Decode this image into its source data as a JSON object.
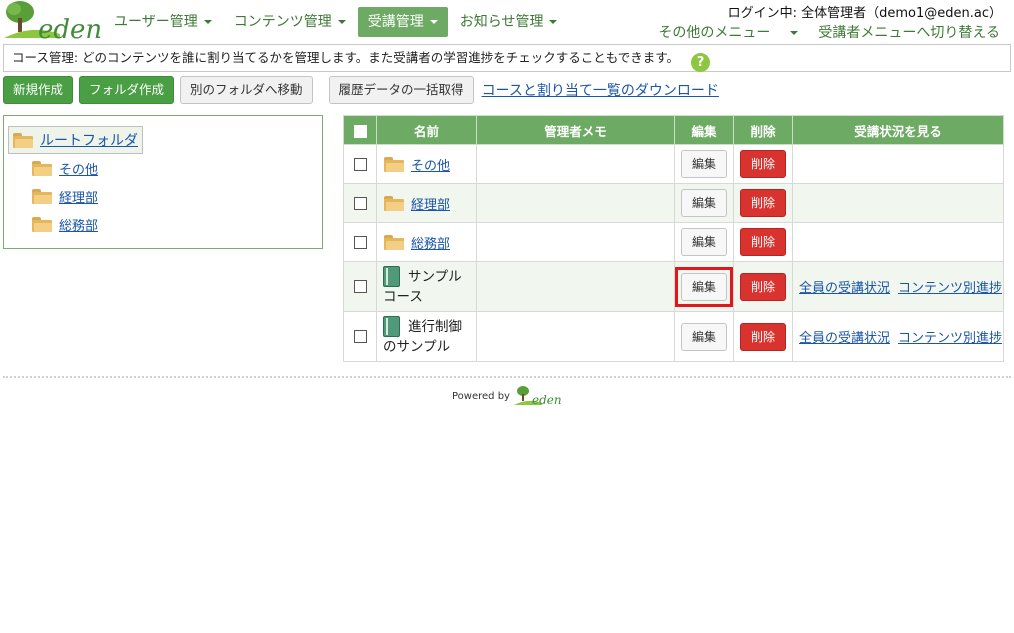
{
  "header": {
    "logo_text": "eden",
    "nav": [
      {
        "label": "ユーザー管理",
        "active": false
      },
      {
        "label": "コンテンツ管理",
        "active": false
      },
      {
        "label": "受講管理",
        "active": true
      },
      {
        "label": "お知らせ管理",
        "active": false
      }
    ],
    "login_text": "ログイン中: 全体管理者（demo1@eden.ac）",
    "other_menu": "その他のメニュー",
    "switch_menu": "受講者メニューへ切り替える"
  },
  "info": {
    "text": "コース管理: どのコンテンツを誰に割り当てるかを管理します。また受講者の学習進捗をチェックすることもできます。",
    "help_label": "?"
  },
  "toolbar": {
    "new": "新規作成",
    "new_folder": "フォルダ作成",
    "move": "別のフォルダへ移動",
    "history": "履歴データの一括取得",
    "download": "コースと割り当て一覧のダウンロード"
  },
  "tree": {
    "root": "ルートフォルダ",
    "children": [
      "その他",
      "経理部",
      "総務部"
    ]
  },
  "table": {
    "headers": {
      "name": "名前",
      "memo": "管理者メモ",
      "edit": "編集",
      "delete": "削除",
      "status": "受講状況を見る"
    },
    "edit_label": "編集",
    "delete_label": "削除",
    "status_all": "全員の受講状況",
    "status_content": "コンテンツ別進捗",
    "rows": [
      {
        "type": "folder",
        "name_1": "その他",
        "name_2": ""
      },
      {
        "type": "folder",
        "name_1": "経理部",
        "name_2": ""
      },
      {
        "type": "folder",
        "name_1": "総務部",
        "name_2": ""
      },
      {
        "type": "course",
        "name_1": "サンプル",
        "name_2": "コース"
      },
      {
        "type": "course",
        "name_1": "進行制御",
        "name_2": "のサンプル"
      }
    ]
  },
  "footer": {
    "powered_by": "Powered by",
    "logo_text": "eden"
  },
  "colors": {
    "brand_green": "#6daa63",
    "button_green": "#4a9e44",
    "delete_red": "#d9332f",
    "highlight_red": "#e0181b",
    "link_blue": "#1a55a8"
  }
}
